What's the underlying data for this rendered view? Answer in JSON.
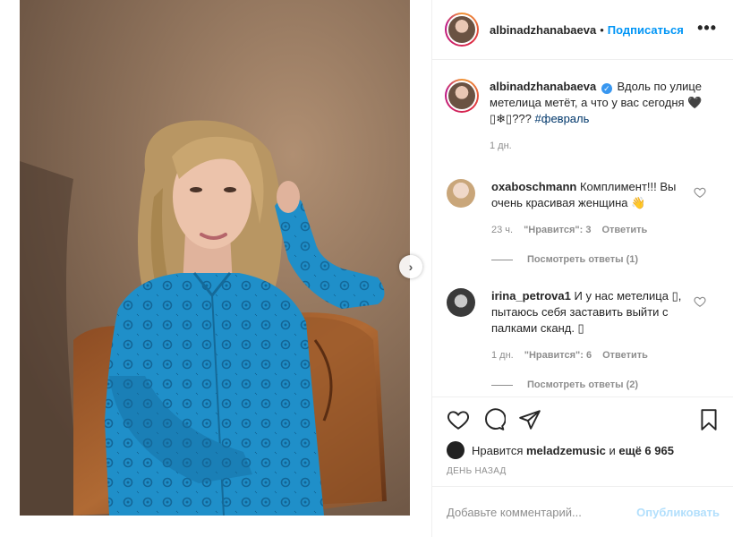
{
  "post": {
    "username": "albinadzhanabaeva",
    "follow_label": "Подписаться",
    "more_icon": "more-horizontal-icon"
  },
  "caption": {
    "username": "albinadzhanabaeva",
    "text_before_tag": "Вдоль по улице метелица метёт, а что у вас сегодня 🖤▯❄▯??? ",
    "hashtag": "#февраль",
    "time": "1 дн."
  },
  "comments": [
    {
      "username": "oxaboschmann",
      "text": "Комплимент!!! Вы очень красивая женщина 👋",
      "time": "23 ч.",
      "likes": "\"Нравится\": 3",
      "reply_label": "Ответить",
      "view_replies": "Посмотреть ответы (1)"
    },
    {
      "username": "irina_petrova1",
      "text": "И у нас метелица ▯, пытаюсь себя заставить выйти с палками сканд. ▯",
      "time": "1 дн.",
      "likes": "\"Нравится\": 6",
      "reply_label": "Ответить",
      "view_replies": "Посмотреть ответы (2)"
    }
  ],
  "likes": {
    "prefix": "Нравится",
    "user": "meladzemusic",
    "and": "и",
    "others": "ещё 6 965"
  },
  "date_label": "ДЕНЬ НАЗАД",
  "comment_box": {
    "placeholder": "Добавьте комментарий...",
    "publish_label": "Опубликовать"
  },
  "colors": {
    "accent": "#0095f6",
    "shirt": "#1f8fc9",
    "background_photo": "#9a7c61"
  }
}
